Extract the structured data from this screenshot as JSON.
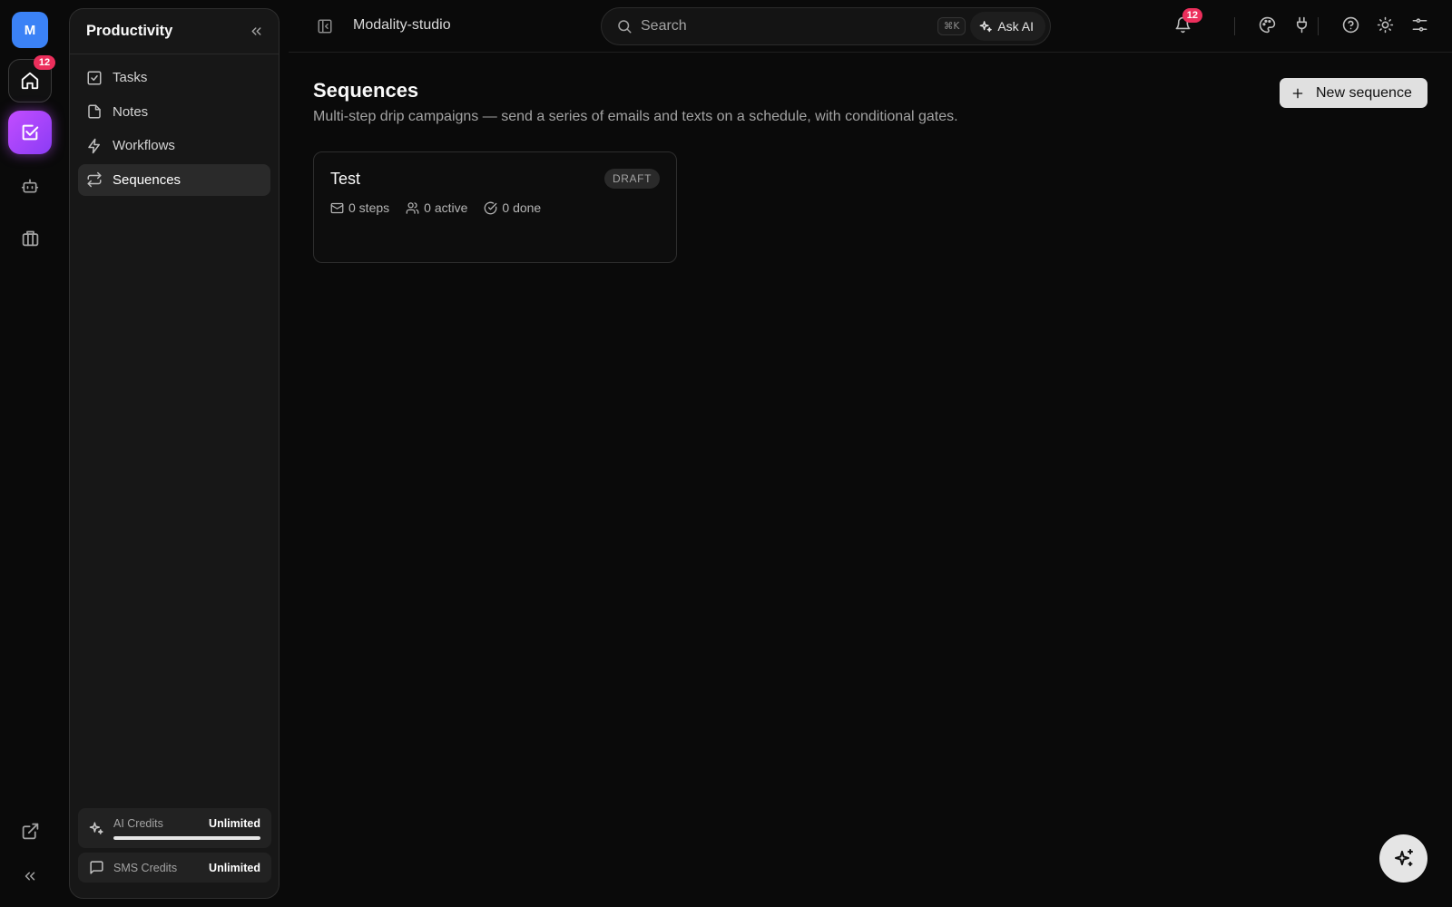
{
  "rail": {
    "workspace_initial": "M",
    "home_badge": "12"
  },
  "sidebar": {
    "title": "Productivity",
    "items": [
      {
        "label": "Tasks",
        "icon": "checkbox-icon",
        "active": false
      },
      {
        "label": "Notes",
        "icon": "file-icon",
        "active": false
      },
      {
        "label": "Workflows",
        "icon": "lightning-icon",
        "active": false
      },
      {
        "label": "Sequences",
        "icon": "repeat-icon",
        "active": true
      }
    ],
    "credits": {
      "ai": {
        "label": "AI Credits",
        "value": "Unlimited",
        "fill": 1.0
      },
      "sms": {
        "label": "SMS Credits",
        "value": "Unlimited"
      }
    }
  },
  "topbar": {
    "workspace_name": "Modality-studio",
    "search_placeholder": "Search",
    "search_shortcut": "⌘K",
    "ask_ai": "Ask AI",
    "notifications_badge": "12"
  },
  "main": {
    "title": "Sequences",
    "subtitle": "Multi-step drip campaigns — send a series of emails and texts on a schedule, with conditional gates.",
    "new_button": "New sequence",
    "sequences": [
      {
        "name": "Test",
        "status": "DRAFT",
        "steps": "0 steps",
        "active": "0 active",
        "done": "0 done"
      }
    ]
  },
  "colors": {
    "background": "#0a0a0a",
    "accent_gradient_start": "#c24dff",
    "accent_gradient_end": "#8b3cf5",
    "badge": "#ec2f5c",
    "workspace_avatar": "#3b82f6"
  }
}
